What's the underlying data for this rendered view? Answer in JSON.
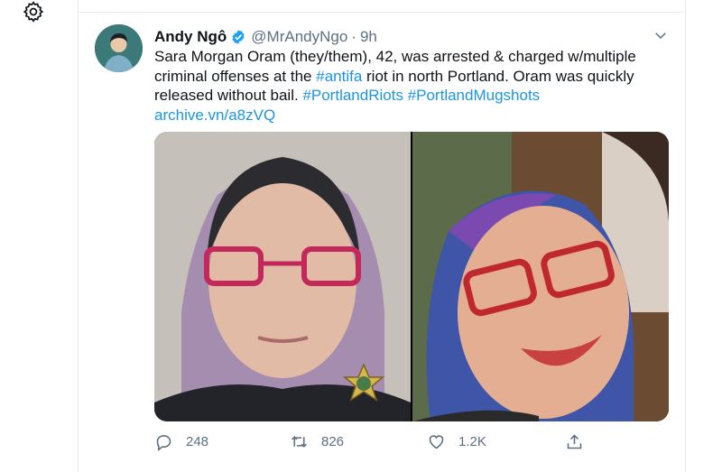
{
  "sidebar": {
    "settings_icon": "gear-icon"
  },
  "tweet": {
    "author_name": "Andy Ngô",
    "handle": "@MrAndyNgo",
    "separator": "·",
    "time": "9h",
    "text": {
      "part1": "Sara Morgan Oram (they/them), 42, was arrested & charged w/multiple criminal offenses at the ",
      "hashtag_antifa": "#antifa",
      "part2": " riot in north Portland. Oram was quickly released without bail. ",
      "hashtag_riots": "#PortlandRiots",
      "hashtag_mugshots": "#PortlandMugshots",
      "link": "archive.vn/a8zVQ"
    },
    "actions": {
      "replies": "248",
      "retweets": "826",
      "likes": "1.2K"
    }
  },
  "colors": {
    "link": "#1b95e0",
    "verified": "#1da1f2",
    "muted": "#5b7083",
    "divider": "#e6ecf0"
  }
}
